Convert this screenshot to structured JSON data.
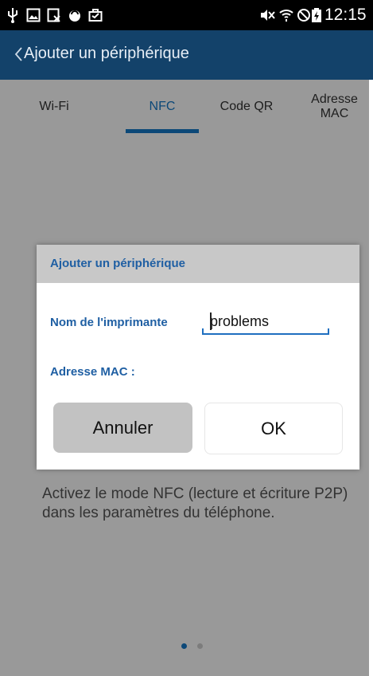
{
  "status_bar": {
    "time": "12:15",
    "icons_left": [
      "usb-icon",
      "gallery-icon",
      "image-icon",
      "lock-icon",
      "briefcase-icon"
    ],
    "icons_right": [
      "mute-icon",
      "wifi-icon",
      "blocked-icon",
      "battery-icon"
    ]
  },
  "app_bar": {
    "back_symbol": "<",
    "title": "Ajouter un périphérique"
  },
  "tabs": [
    {
      "label": "Wi-Fi"
    },
    {
      "label": "NFC"
    },
    {
      "label": "Code QR"
    },
    {
      "label": "Adresse MAC"
    }
  ],
  "active_tab": "NFC",
  "content": {
    "hint": "Activez le mode NFC (lecture et écriture P2P) dans les paramètres du téléphone.",
    "page_dots": 2,
    "current_page": 1
  },
  "dialog": {
    "title": "Ajouter un périphérique",
    "printer_name_label": "Nom de l'imprimante",
    "printer_name_value": "problems",
    "mac_label": "Adresse MAC  :",
    "mac_value": "",
    "cancel_label": "Annuler",
    "ok_label": "OK"
  },
  "colors": {
    "app_bar": "#13426a",
    "accent": "#1479c8",
    "dialog_label": "#1f5fa3"
  }
}
